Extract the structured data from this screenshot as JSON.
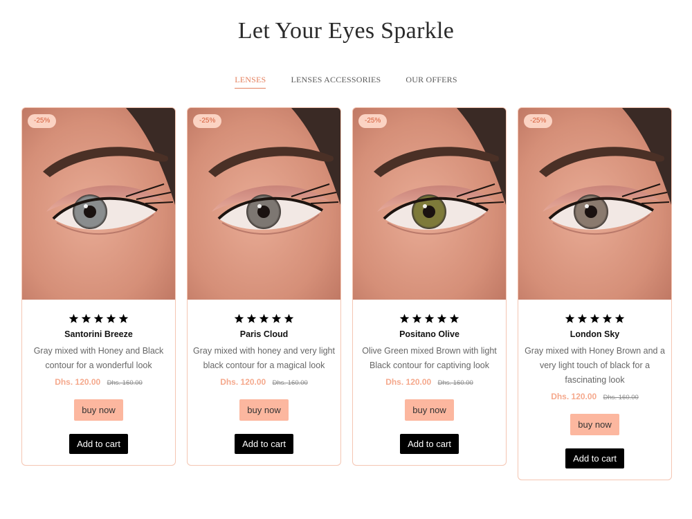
{
  "page": {
    "title": "Let Your Eyes Sparkle"
  },
  "tabs": [
    {
      "label": "LENSES",
      "active": true
    },
    {
      "label": "LENSES ACCESSORIES",
      "active": false
    },
    {
      "label": "OUR OFFERS",
      "active": false
    }
  ],
  "products": [
    {
      "badge": "-25%",
      "rating": 5,
      "name": "Santorini Breeze",
      "description": "Gray mixed with Honey and Black contour for a wonderful look",
      "price": "Dhs. 120.00",
      "old_price": "Dhs. 160.00",
      "buy_label": "buy now",
      "cart_label": "Add to cart",
      "iris_color": "#8a8d8e"
    },
    {
      "badge": "-25%",
      "rating": 5,
      "name": "Paris Cloud",
      "description": "Gray mixed with honey and very light black contour for a magical look",
      "price": "Dhs. 120.00",
      "old_price": "Dhs. 160.00",
      "buy_label": "buy now",
      "cart_label": "Add to cart",
      "iris_color": "#7d7772"
    },
    {
      "badge": "-25%",
      "rating": 5,
      "name": "Positano Olive",
      "description": "Olive Green mixed Brown with light Black contour for captiving look",
      "price": "Dhs. 120.00",
      "old_price": "Dhs. 160.00",
      "buy_label": "buy now",
      "cart_label": "Add to cart",
      "iris_color": "#7e7a3a"
    },
    {
      "badge": "-25%",
      "rating": 5,
      "name": "London Sky",
      "description": "Gray mixed with Honey Brown and a very light touch of black for a fascinating look",
      "price": "Dhs. 120.00",
      "old_price": "Dhs. 160.00",
      "buy_label": "buy now",
      "cart_label": "Add to cart",
      "iris_color": "#8a7a6e"
    }
  ],
  "colors": {
    "accent": "#e4805e",
    "badge_bg": "#fbd3c3",
    "buy_bg": "#fcb79f",
    "cart_bg": "#000000",
    "price": "#f5a98d",
    "card_border": "#f4c5b2"
  }
}
